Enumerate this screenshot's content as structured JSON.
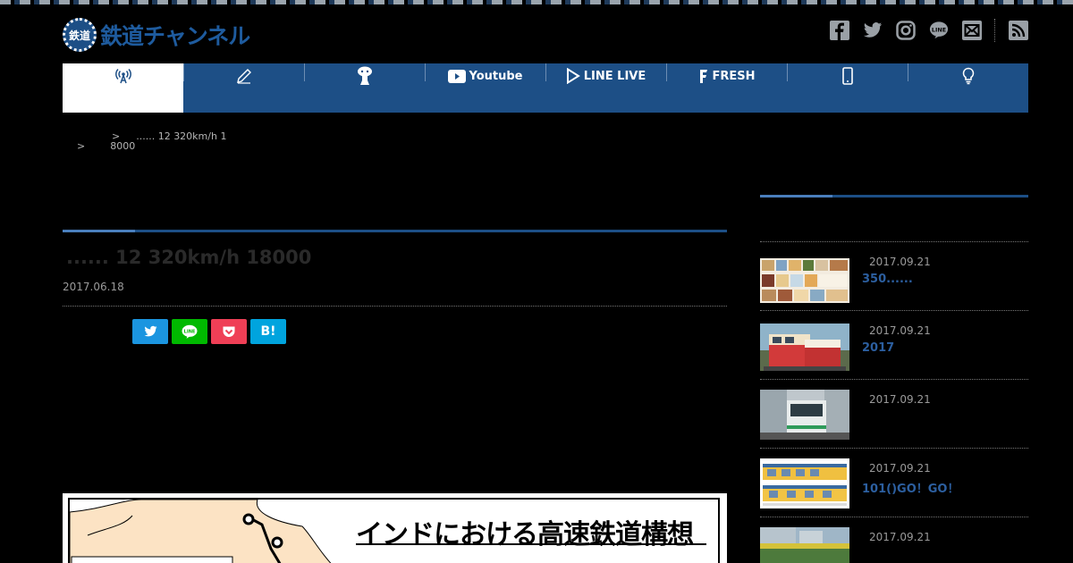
{
  "site": {
    "name": "鉄道チャンネル",
    "badge": "鉄道"
  },
  "header": {
    "social": [
      {
        "name": "facebook-icon"
      },
      {
        "name": "twitter-icon"
      },
      {
        "name": "instagram-icon"
      },
      {
        "name": "line-icon",
        "label": "LINE"
      },
      {
        "name": "mail-icon"
      },
      {
        "name": "rss-icon"
      }
    ]
  },
  "nav": {
    "items": [
      {
        "icon": "broadcast-icon",
        "label": ""
      },
      {
        "icon": "pencil-icon",
        "label": ""
      },
      {
        "icon": "mascot-icon",
        "label": ""
      },
      {
        "icon": "youtube-icon",
        "label": "Youtube"
      },
      {
        "icon": "line-live-icon",
        "label": "LINE LIVE"
      },
      {
        "icon": "fresh-icon",
        "label": "FRESH"
      },
      {
        "icon": "smartphone-icon",
        "label": ""
      },
      {
        "icon": "lightbulb-icon",
        "label": ""
      }
    ]
  },
  "breadcrumb": {
    "sep": ">",
    "line1": "...... 12 320km/h 1",
    "line2": "8000"
  },
  "article": {
    "title": "...... 12 320km/h 18000",
    "date": "2017.06.18",
    "share": {
      "hatena_label": "B!"
    },
    "image_title": "インドにおける高速鉄道構想"
  },
  "sidebar": {
    "items": [
      {
        "date": "2017.09.21",
        "text": "350......"
      },
      {
        "date": "2017.09.21",
        "text": "2017"
      },
      {
        "date": "2017.09.21",
        "text": ""
      },
      {
        "date": "2017.09.21",
        "text": "101()GO！GO！"
      },
      {
        "date": "2017.09.21",
        "text": ""
      }
    ]
  },
  "colors": {
    "brand": "#1d4f86",
    "accent": "#4a7fbd",
    "twitter": "#1b95e0",
    "line": "#00b900",
    "pocket": "#ef3f56",
    "hatena": "#00a4de"
  }
}
